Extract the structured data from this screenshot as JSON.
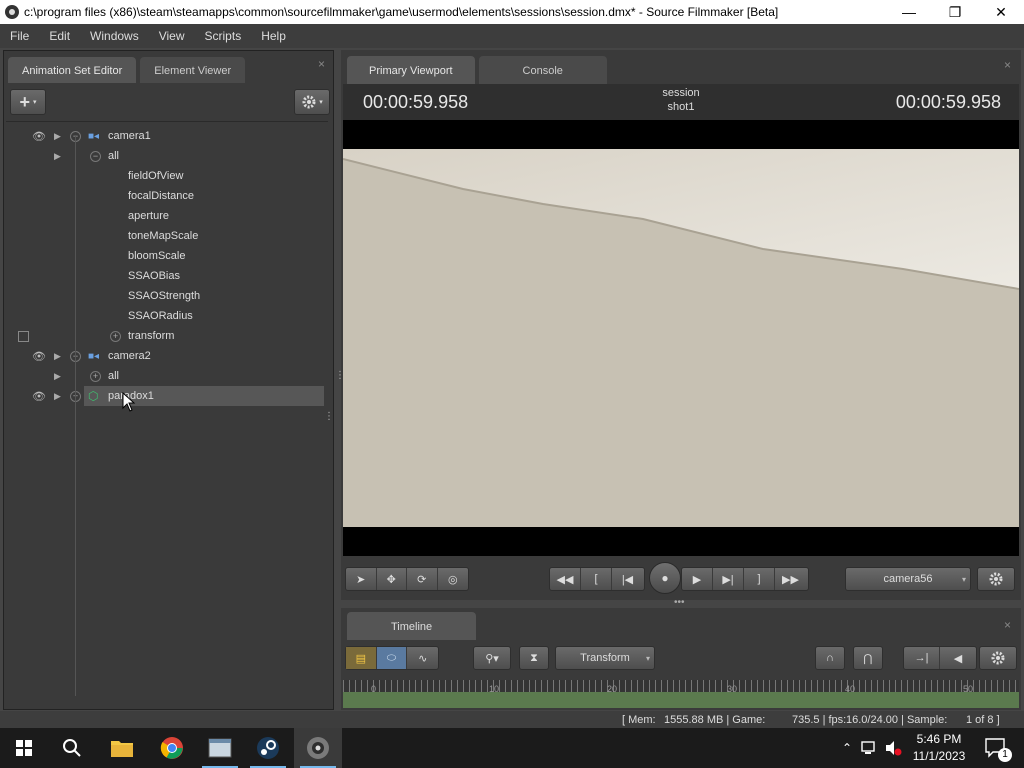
{
  "window": {
    "title": "c:\\program files (x86)\\steam\\steamapps\\common\\sourcefilmmaker\\game\\usermod\\elements\\sessions\\session.dmx* - Source Filmmaker [Beta]",
    "minimize": "—",
    "maximize": "❐",
    "close": "✕"
  },
  "menu": [
    "File",
    "Edit",
    "Windows",
    "View",
    "Scripts",
    "Help"
  ],
  "left_panel": {
    "tabs": [
      "Animation Set Editor",
      "Element Viewer"
    ],
    "close": "×",
    "add_label": "+",
    "settings_icon": "gear-icon",
    "tree": [
      {
        "label": "camera1",
        "type": "camera"
      },
      {
        "label": "all",
        "type": "group"
      },
      {
        "label": "fieldOfView",
        "type": "control"
      },
      {
        "label": "focalDistance",
        "type": "control"
      },
      {
        "label": "aperture",
        "type": "control"
      },
      {
        "label": "toneMapScale",
        "type": "control"
      },
      {
        "label": "bloomScale",
        "type": "control"
      },
      {
        "label": "SSAOBias",
        "type": "control"
      },
      {
        "label": "SSAOStrength",
        "type": "control"
      },
      {
        "label": "SSAORadius",
        "type": "control"
      },
      {
        "label": "transform",
        "type": "group"
      },
      {
        "label": "camera2",
        "type": "camera"
      },
      {
        "label": "all",
        "type": "group"
      },
      {
        "label": "paradox1",
        "type": "model",
        "selected": true
      }
    ]
  },
  "viewport": {
    "tabs": [
      "Primary Viewport",
      "Console"
    ],
    "close": "×",
    "timecode_left": "00:00:59.958",
    "timecode_right": "00:00:59.958",
    "session": "session",
    "shot": "shot1",
    "camera_dropdown": "camera56"
  },
  "timeline": {
    "tab": "Timeline",
    "close": "×",
    "mode_dropdown": "Transform",
    "ruler_numbers": [
      "0",
      "10",
      "20",
      "30",
      "40",
      "50"
    ]
  },
  "status": {
    "mem": "[ Mem:",
    "mem_value": "1555.88 MB | Game:",
    "game_value": "735.5 | fps:",
    "fps_value": "16.0/24.00 | Sample:",
    "sample_value": "1 of 8 ]"
  },
  "taskbar": {
    "time": "5:46 PM",
    "date": "11/1/2023",
    "notif_count": "1"
  },
  "colors": {
    "accent": "#76b9ed",
    "selected_row": "#575757",
    "panel_bg": "#3a3a3a",
    "scene": "#c9c3b6"
  }
}
